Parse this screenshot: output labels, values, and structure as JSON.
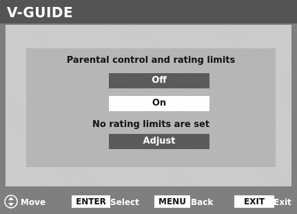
{
  "header": {
    "title": "V-GUIDE"
  },
  "panel": {
    "heading": "Parental control and rating limits",
    "off_label": "Off",
    "on_label": "On",
    "status_text": "No rating limits are set",
    "adjust_label": "Adjust"
  },
  "footer": {
    "move_icon": "move-arrows-icon",
    "move_label": "Move",
    "enter_key": "ENTER",
    "enter_label": "Select",
    "menu_key": "MENU",
    "menu_label": "Back",
    "exit_key": "EXIT",
    "exit_label": "Exit"
  },
  "colors": {
    "title_bar": "#545454",
    "content_bg": "#c8c8c8",
    "panel_bg": "#b3b3b3",
    "button_dark": "#5a5a5a",
    "button_selected": "#ffffff"
  }
}
